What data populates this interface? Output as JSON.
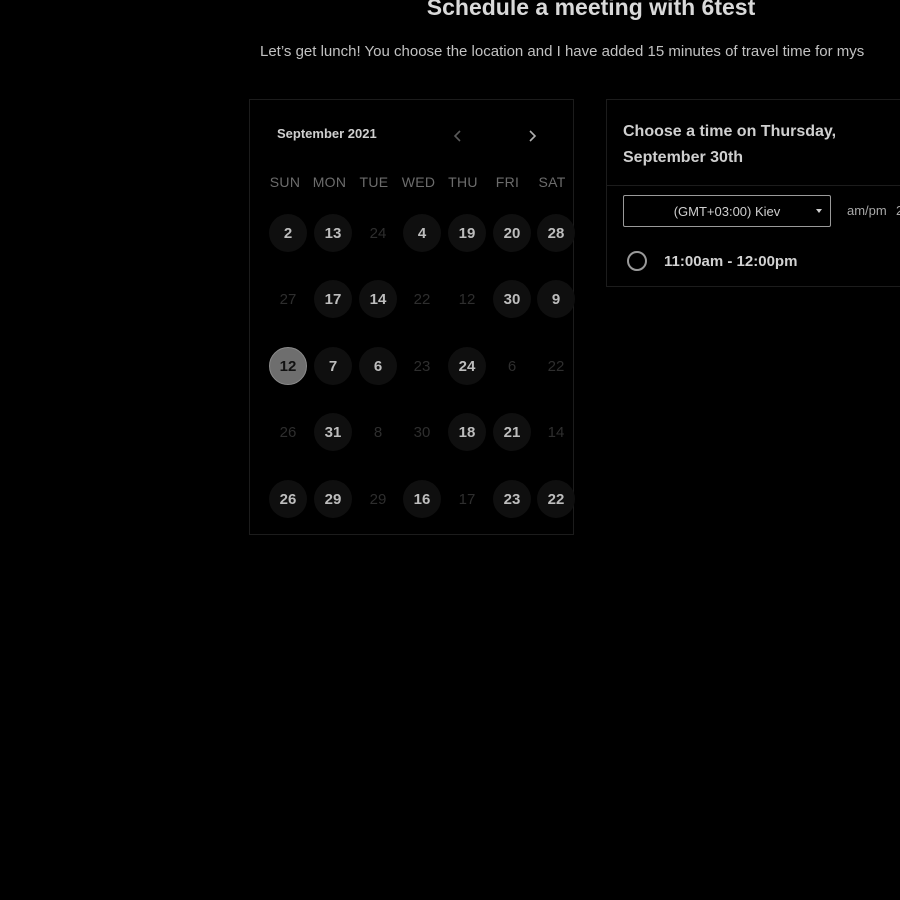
{
  "header": {
    "title": "Schedule a meeting with 6test",
    "subtitle": "Let’s get lunch! You choose the location and I have added 15 minutes of travel time for mys"
  },
  "calendar": {
    "month_label": "September 2021",
    "prev_icon": "chevron-left-icon",
    "next_icon": "chevron-right-icon",
    "weekdays": [
      "SUN",
      "MON",
      "TUE",
      "WED",
      "THU",
      "FRI",
      "SAT"
    ],
    "weeks": [
      [
        {
          "label": "2",
          "state": "active"
        },
        {
          "label": "13",
          "state": "active"
        },
        {
          "label": "24",
          "state": "inactive"
        },
        {
          "label": "4",
          "state": "active"
        },
        {
          "label": "19",
          "state": "active"
        },
        {
          "label": "20",
          "state": "active"
        },
        {
          "label": "28",
          "state": "active"
        }
      ],
      [
        {
          "label": "27",
          "state": "inactive"
        },
        {
          "label": "17",
          "state": "active"
        },
        {
          "label": "14",
          "state": "active"
        },
        {
          "label": "22",
          "state": "inactive"
        },
        {
          "label": "12",
          "state": "inactive"
        },
        {
          "label": "30",
          "state": "active"
        },
        {
          "label": "9",
          "state": "active"
        }
      ],
      [
        {
          "label": "12",
          "state": "selected"
        },
        {
          "label": "7",
          "state": "active"
        },
        {
          "label": "6",
          "state": "active"
        },
        {
          "label": "23",
          "state": "inactive"
        },
        {
          "label": "24",
          "state": "active"
        },
        {
          "label": "6",
          "state": "inactive"
        },
        {
          "label": "22",
          "state": "inactive"
        }
      ],
      [
        {
          "label": "26",
          "state": "inactive"
        },
        {
          "label": "31",
          "state": "active"
        },
        {
          "label": "8",
          "state": "inactive"
        },
        {
          "label": "30",
          "state": "inactive"
        },
        {
          "label": "18",
          "state": "active"
        },
        {
          "label": "21",
          "state": "active"
        },
        {
          "label": "14",
          "state": "inactive"
        }
      ],
      [
        {
          "label": "26",
          "state": "active"
        },
        {
          "label": "29",
          "state": "active"
        },
        {
          "label": "29",
          "state": "inactive"
        },
        {
          "label": "16",
          "state": "active"
        },
        {
          "label": "17",
          "state": "inactive"
        },
        {
          "label": "23",
          "state": "active"
        },
        {
          "label": "22",
          "state": "active"
        }
      ]
    ]
  },
  "time_panel": {
    "heading": "Choose a time on Thursday, September 30th",
    "timezone": "(GMT+03:00) Kiev",
    "format_label": "am/pm",
    "format_toggle": "2",
    "slots": [
      "11:00am - 12:00pm"
    ]
  },
  "colors": {
    "background": "#000000",
    "selected_day": "#6e6e6e",
    "active_day_bg": "#0f0f0f",
    "border": "#1c1c1c"
  }
}
